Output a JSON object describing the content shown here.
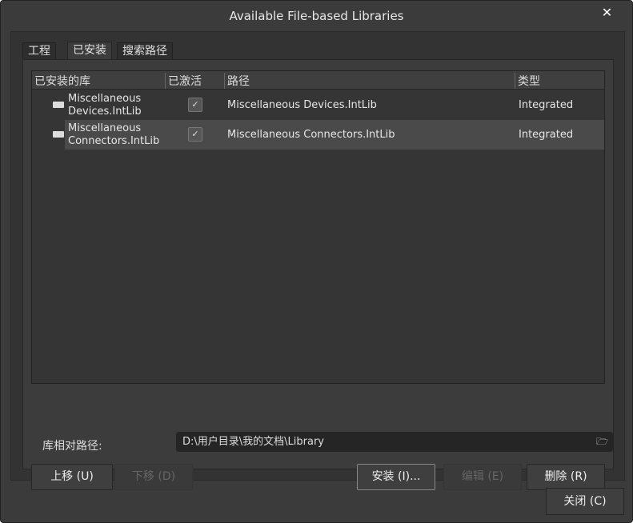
{
  "window": {
    "title": "Available File-based Libraries",
    "close_glyph": "✕"
  },
  "tabs": [
    {
      "label": "工程"
    },
    {
      "label": "已安装"
    },
    {
      "label": "搜索路径"
    }
  ],
  "table": {
    "headers": [
      "已安装的库",
      "已激活",
      "路径",
      "类型"
    ],
    "rows": [
      {
        "name_line1": "Miscellaneous",
        "name_line2": "Devices.IntLib",
        "active": "✓",
        "path": "Miscellaneous Devices.IntLib",
        "type": "Integrated"
      },
      {
        "name_line1": "Miscellaneous",
        "name_line2": "Connectors.IntLib",
        "active": "✓",
        "path": "Miscellaneous Connectors.IntLib",
        "type": "Integrated"
      }
    ]
  },
  "path_label": "库相对路径:",
  "path_value": "D:\\用户目录\\我的文档\\Library",
  "folder_glyph": "🗁",
  "buttons": {
    "up": "上移 (U)",
    "down": "下移 (D)",
    "install": "安装 (I)...",
    "edit": "编辑 (E)",
    "remove": "删除 (R)",
    "close": "关闭 (C)"
  }
}
